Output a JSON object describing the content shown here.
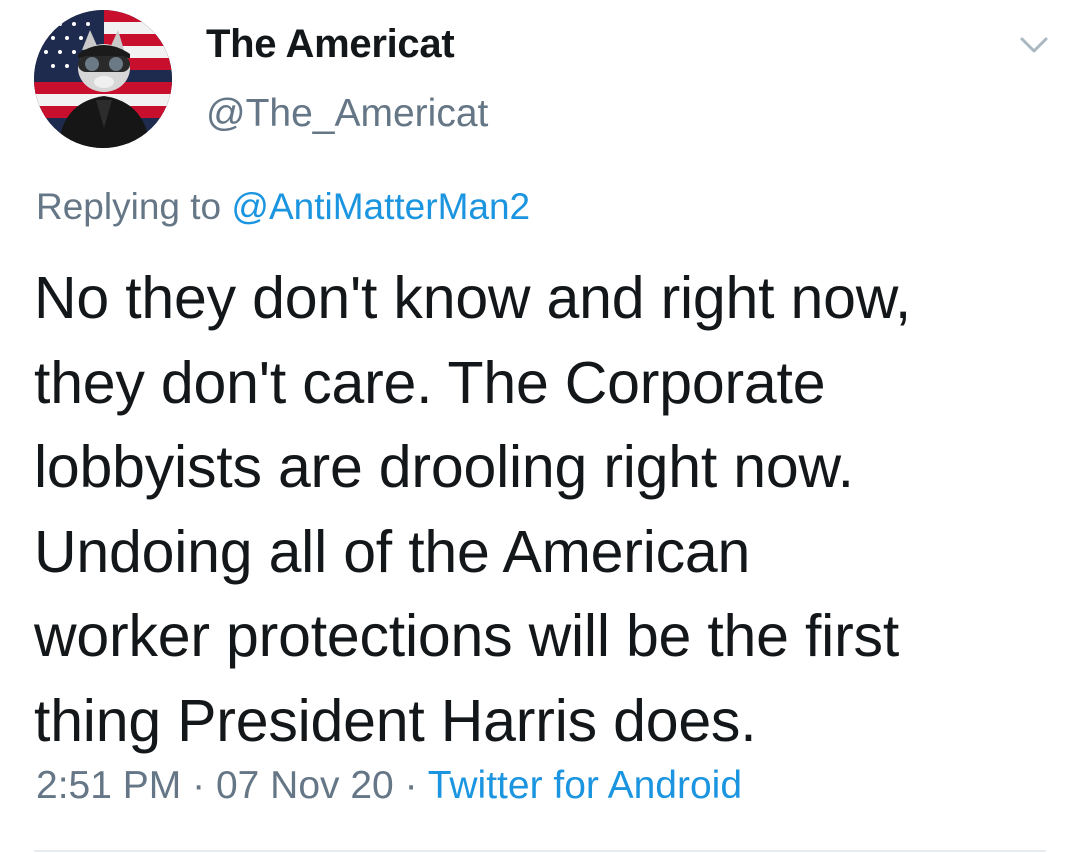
{
  "tweet": {
    "author": {
      "display_name": "The Americat",
      "handle": "@The_Americat"
    },
    "reply": {
      "prefix": "Replying to",
      "mention": "@AntiMatterMan2"
    },
    "text": "No they don't know and right now,\nthey don't care.  The Corporate\nlobbyists are drooling right now.\nUndoing all of the American\nworker protections will be the first\nthing President Harris does.",
    "time": "2:51 PM",
    "separator": "·",
    "date": "07 Nov 20",
    "source": "Twitter for Android"
  },
  "colors": {
    "text": "#14171a",
    "secondary": "#657786",
    "link": "#1b95e0",
    "divider": "#e6ecf0"
  },
  "icons": {
    "menu": "chevron-down-icon",
    "avatar": "avatar"
  }
}
